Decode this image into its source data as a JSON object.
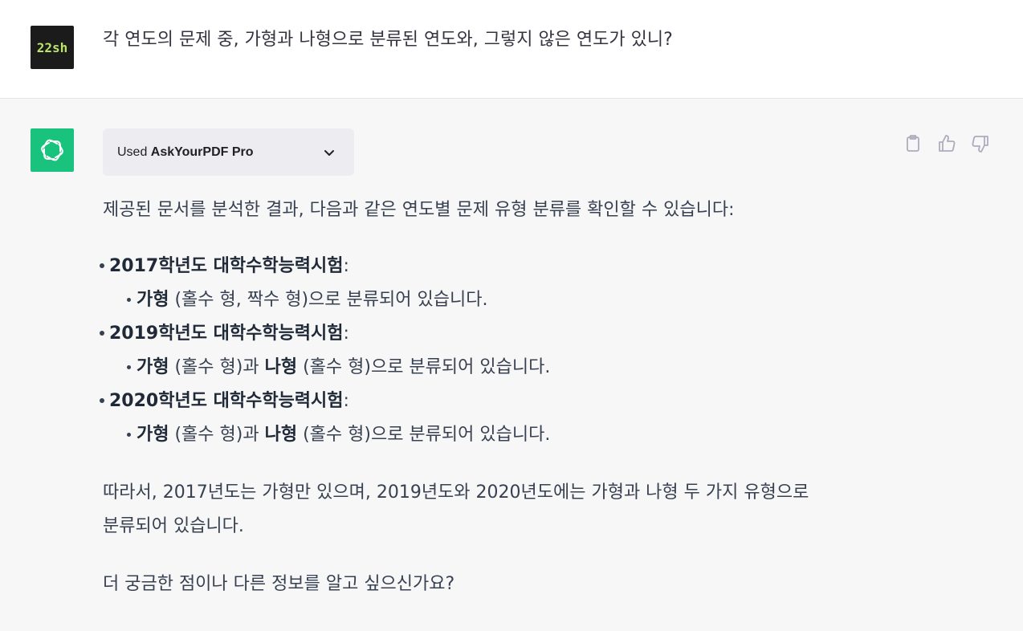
{
  "user": {
    "avatar_text": "22sh",
    "message": "각 연도의 문제 중, 가형과 나형으로 분류된 연도와, 그렇지 않은 연도가 있니?"
  },
  "assistant": {
    "plugin": {
      "prefix": "Used ",
      "name": "AskYourPDF Pro"
    },
    "intro": "제공된 문서를 분석한 결과, 다음과 같은 연도별 문제 유형 분류를 확인할 수 있습니다:",
    "years": [
      {
        "title": "2017학년도 대학수학능력시험",
        "colon": ":",
        "item": {
          "ga": "가형",
          "ga_detail": " (홀수 형, 짝수 형)으로 분류되어 있습니다."
        }
      },
      {
        "title": "2019학년도 대학수학능력시험",
        "colon": ":",
        "item": {
          "ga": "가형",
          "ga_detail": " (홀수 형)과 ",
          "na": "나형",
          "na_detail": " (홀수 형)으로 분류되어 있습니다."
        }
      },
      {
        "title": "2020학년도 대학수학능력시험",
        "colon": ":",
        "item": {
          "ga": "가형",
          "ga_detail": " (홀수 형)과 ",
          "na": "나형",
          "na_detail": " (홀수 형)으로 분류되어 있습니다."
        }
      }
    ],
    "conclusion_line1": "따라서, 2017년도는 가형만 있으며, 2019년도와 2020년도에는 가형과 나형 두 가지 유형으로",
    "conclusion_line2": "분류되어 있습니다.",
    "followup": "더 궁금한 점이나 다른 정보를 알고 싶으신가요?"
  },
  "icons": {
    "plugin_toggle": "chevron-down-icon",
    "copy": "clipboard-icon",
    "like": "thumbs-up-icon",
    "dislike": "thumbs-down-icon",
    "assistant_logo": "openai-logo-icon"
  },
  "colors": {
    "assistant_avatar_bg": "#19c37d",
    "user_avatar_bg": "#1b1b1b",
    "assistant_row_bg": "#f7f7f8",
    "plugin_box_bg": "#ececf1"
  }
}
